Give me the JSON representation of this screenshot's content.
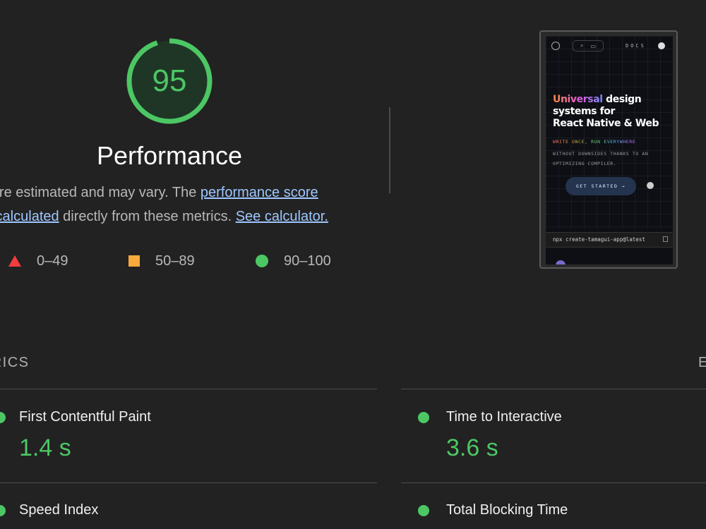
{
  "gauge": {
    "score": "95",
    "score_fraction": 0.95,
    "color": "#4cc764"
  },
  "category": {
    "title": "Performance"
  },
  "description": {
    "line1_text": "ues are estimated and may vary. The ",
    "line1_link": "performance score",
    "line2_link": "s calculated",
    "line2_text": " directly from these metrics. ",
    "line2_link2": "See calculator."
  },
  "legend": [
    {
      "range": "0–49",
      "shape": "triangle",
      "color": "#f33d3d"
    },
    {
      "range": "50–89",
      "shape": "square",
      "color": "#f7aa3b"
    },
    {
      "range": "90–100",
      "shape": "circle",
      "color": "#4cc764"
    }
  ],
  "screenshot": {
    "nav_docs": "DOCS",
    "headline_accent": "Universal",
    "headline_rest_1": " design",
    "headline_line2": "systems for",
    "headline_line3": "React Native & Web",
    "tagline1": "WRITE ONCE, RUN EVERYWHERE",
    "tagline2": "WITHOUT DOWNSIDES THANKS TO AN OPTIMIZING COMPILER.",
    "cta_label": "GET STARTED →",
    "command": "npx create-tamagui-app@latest"
  },
  "metrics": {
    "section_label": "TRICS",
    "section_label_right": "E",
    "items": [
      {
        "title": "First Contentful Paint",
        "value": "1.4 s"
      },
      {
        "title": "Time to Interactive",
        "value": "3.6 s"
      },
      {
        "title": "Speed Index",
        "value": ""
      },
      {
        "title": "Total Blocking Time",
        "value": ""
      }
    ]
  }
}
